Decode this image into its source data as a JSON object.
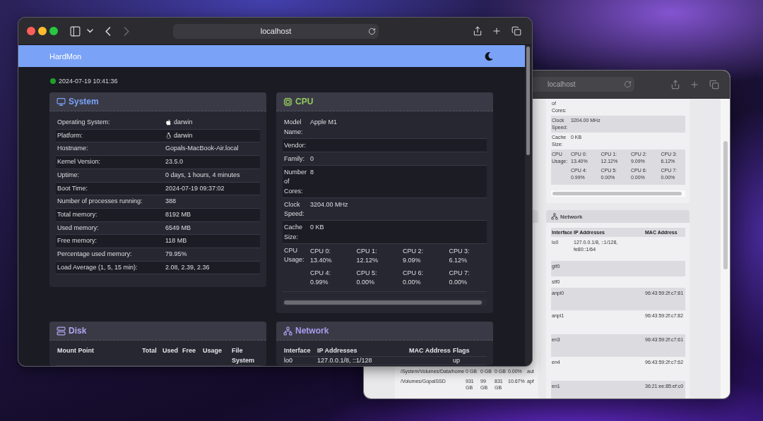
{
  "front_window": {
    "toolbar": {
      "address": "localhost",
      "back_disabled": false,
      "forward_disabled": true
    },
    "app": {
      "title": "HardMon",
      "status": {
        "connected": true,
        "time": "2024-07-19 10:41:36"
      },
      "cards": [
        {
          "kind": "system",
          "title": "System",
          "color": "#7aa2f7",
          "rows": [
            {
              "kind": "os",
              "label": "Operating System:",
              "value": "darwin"
            },
            {
              "kind": "platform",
              "label": "Platform:",
              "value": "darwin"
            },
            {
              "kind": "text",
              "label": "Hostname:",
              "value": "Gopals-MacBook-Air.local"
            },
            {
              "kind": "text",
              "label": "Kernel Version:",
              "value": "23.5.0"
            },
            {
              "kind": "text",
              "label": "Uptime:",
              "value": "0 days, 1 hours, 4 minutes"
            },
            {
              "kind": "text",
              "label": "Boot Time:",
              "value": "2024-07-19 09:37:02"
            },
            {
              "kind": "text",
              "label": "Number of processes running:",
              "value": "388"
            },
            {
              "kind": "text",
              "label": "Total memory:",
              "value": "8192 MB"
            },
            {
              "kind": "text",
              "label": "Used memory:",
              "value": "6549 MB"
            },
            {
              "kind": "text",
              "label": "Free memory:",
              "value": "118 MB"
            },
            {
              "kind": "text",
              "label": "Percentage used memory:",
              "value": "79.95%"
            },
            {
              "kind": "text",
              "label": "Load Average (1, 5, 15 min):",
              "value": "2.08, 2.39, 2.36"
            }
          ]
        },
        {
          "kind": "cpu",
          "title": "CPU",
          "color": "#93c95e",
          "rows": [
            {
              "label": "Model Name:",
              "value": "Apple M1"
            },
            {
              "label": "Vendor:"
            },
            {
              "label": "Family:",
              "value": "0"
            },
            {
              "label": "Number of Cores:",
              "value": "8"
            },
            {
              "label": "Clock Speed:",
              "value": "3204.00 MHz"
            },
            {
              "label": "Cache Size:",
              "value": "0 KB"
            }
          ],
          "usage_label": "CPU Usage:",
          "cores": [
            {
              "name": "CPU 0:",
              "value": "13.40%"
            },
            {
              "name": "CPU 1:",
              "value": "12.12%"
            },
            {
              "name": "CPU 2:",
              "value": "9.09%"
            },
            {
              "name": "CPU 3:",
              "value": "6.12%"
            },
            {
              "name": "CPU 4:",
              "value": "0.99%"
            },
            {
              "name": "CPU 5:",
              "value": "0.00%"
            },
            {
              "name": "CPU 6:",
              "value": "0.00%"
            },
            {
              "name": "CPU 7:",
              "value": "0.00%"
            }
          ]
        },
        {
          "kind": "disk",
          "title": "Disk",
          "color": "#b3a5f0",
          "columns": [
            "Mount Point",
            "Total",
            "Used",
            "Free",
            "Usage",
            "File System"
          ]
        },
        {
          "kind": "network",
          "title": "Network",
          "color": "#a89ded",
          "columns": [
            "Interface",
            "IP Addresses",
            "MAC Address",
            "Flags"
          ],
          "rows": [
            {
              "interface": "lo0",
              "ips": "127.0.0.1/8, ::1/128",
              "flags": "up"
            }
          ]
        }
      ]
    }
  },
  "back_window": {
    "toolbar": {
      "address": "localhost"
    },
    "disk_rows": [
      {
        "mount": "/System/Volumes/Data/home",
        "total": "0 GB",
        "used": "0 GB",
        "free": "0 GB",
        "usage": "0.00%",
        "file_system": "aut"
      },
      {
        "mount": "/Volumes/GopalSSD",
        "total": "931 GB",
        "used": "99 GB",
        "free": "831 GB",
        "usage": "10.67%",
        "file_system": "apf"
      }
    ],
    "cpu": {
      "rows": [
        {
          "label": "of Cores:"
        },
        {
          "label": "Clock Speed:",
          "value": "3204.00 MHz"
        },
        {
          "label": "Cache Size:",
          "value": "0 KB"
        }
      ],
      "usage_label": "CPU Usage:",
      "cores": [
        {
          "name": "CPU 0:",
          "value": "13.40%"
        },
        {
          "name": "CPU 1:",
          "value": "12.12%"
        },
        {
          "name": "CPU 2:",
          "value": "9.09%"
        },
        {
          "name": "CPU 3:",
          "value": "6.12%"
        },
        {
          "name": "CPU 4:",
          "value": "0.99%"
        },
        {
          "name": "CPU 5:",
          "value": "0.00%"
        },
        {
          "name": "CPU 6:",
          "value": "0.00%"
        },
        {
          "name": "CPU 7:",
          "value": "0.00%"
        }
      ]
    },
    "network": {
      "title": "Network",
      "columns": [
        "Interface",
        "IP Addresses",
        "MAC Address"
      ],
      "rows": [
        {
          "interface": "lo0",
          "ips": "127.0.0.1/8, ::1/128, fe80::1/64"
        },
        {
          "interface": "gif0"
        },
        {
          "interface": "stf0"
        },
        {
          "interface": "anpi0",
          "mac": "96:43:59:2f:c7:81"
        },
        {
          "interface": "anpi1",
          "mac": "96:43:59:2f:c7:82"
        },
        {
          "interface": "en3",
          "mac": "96:43:59:2f:c7:61"
        },
        {
          "interface": "en4",
          "mac": "96:43:59:2f:c7:62"
        },
        {
          "interface": "en1",
          "mac": "36:21:ee:85:ef:c0"
        }
      ]
    }
  }
}
